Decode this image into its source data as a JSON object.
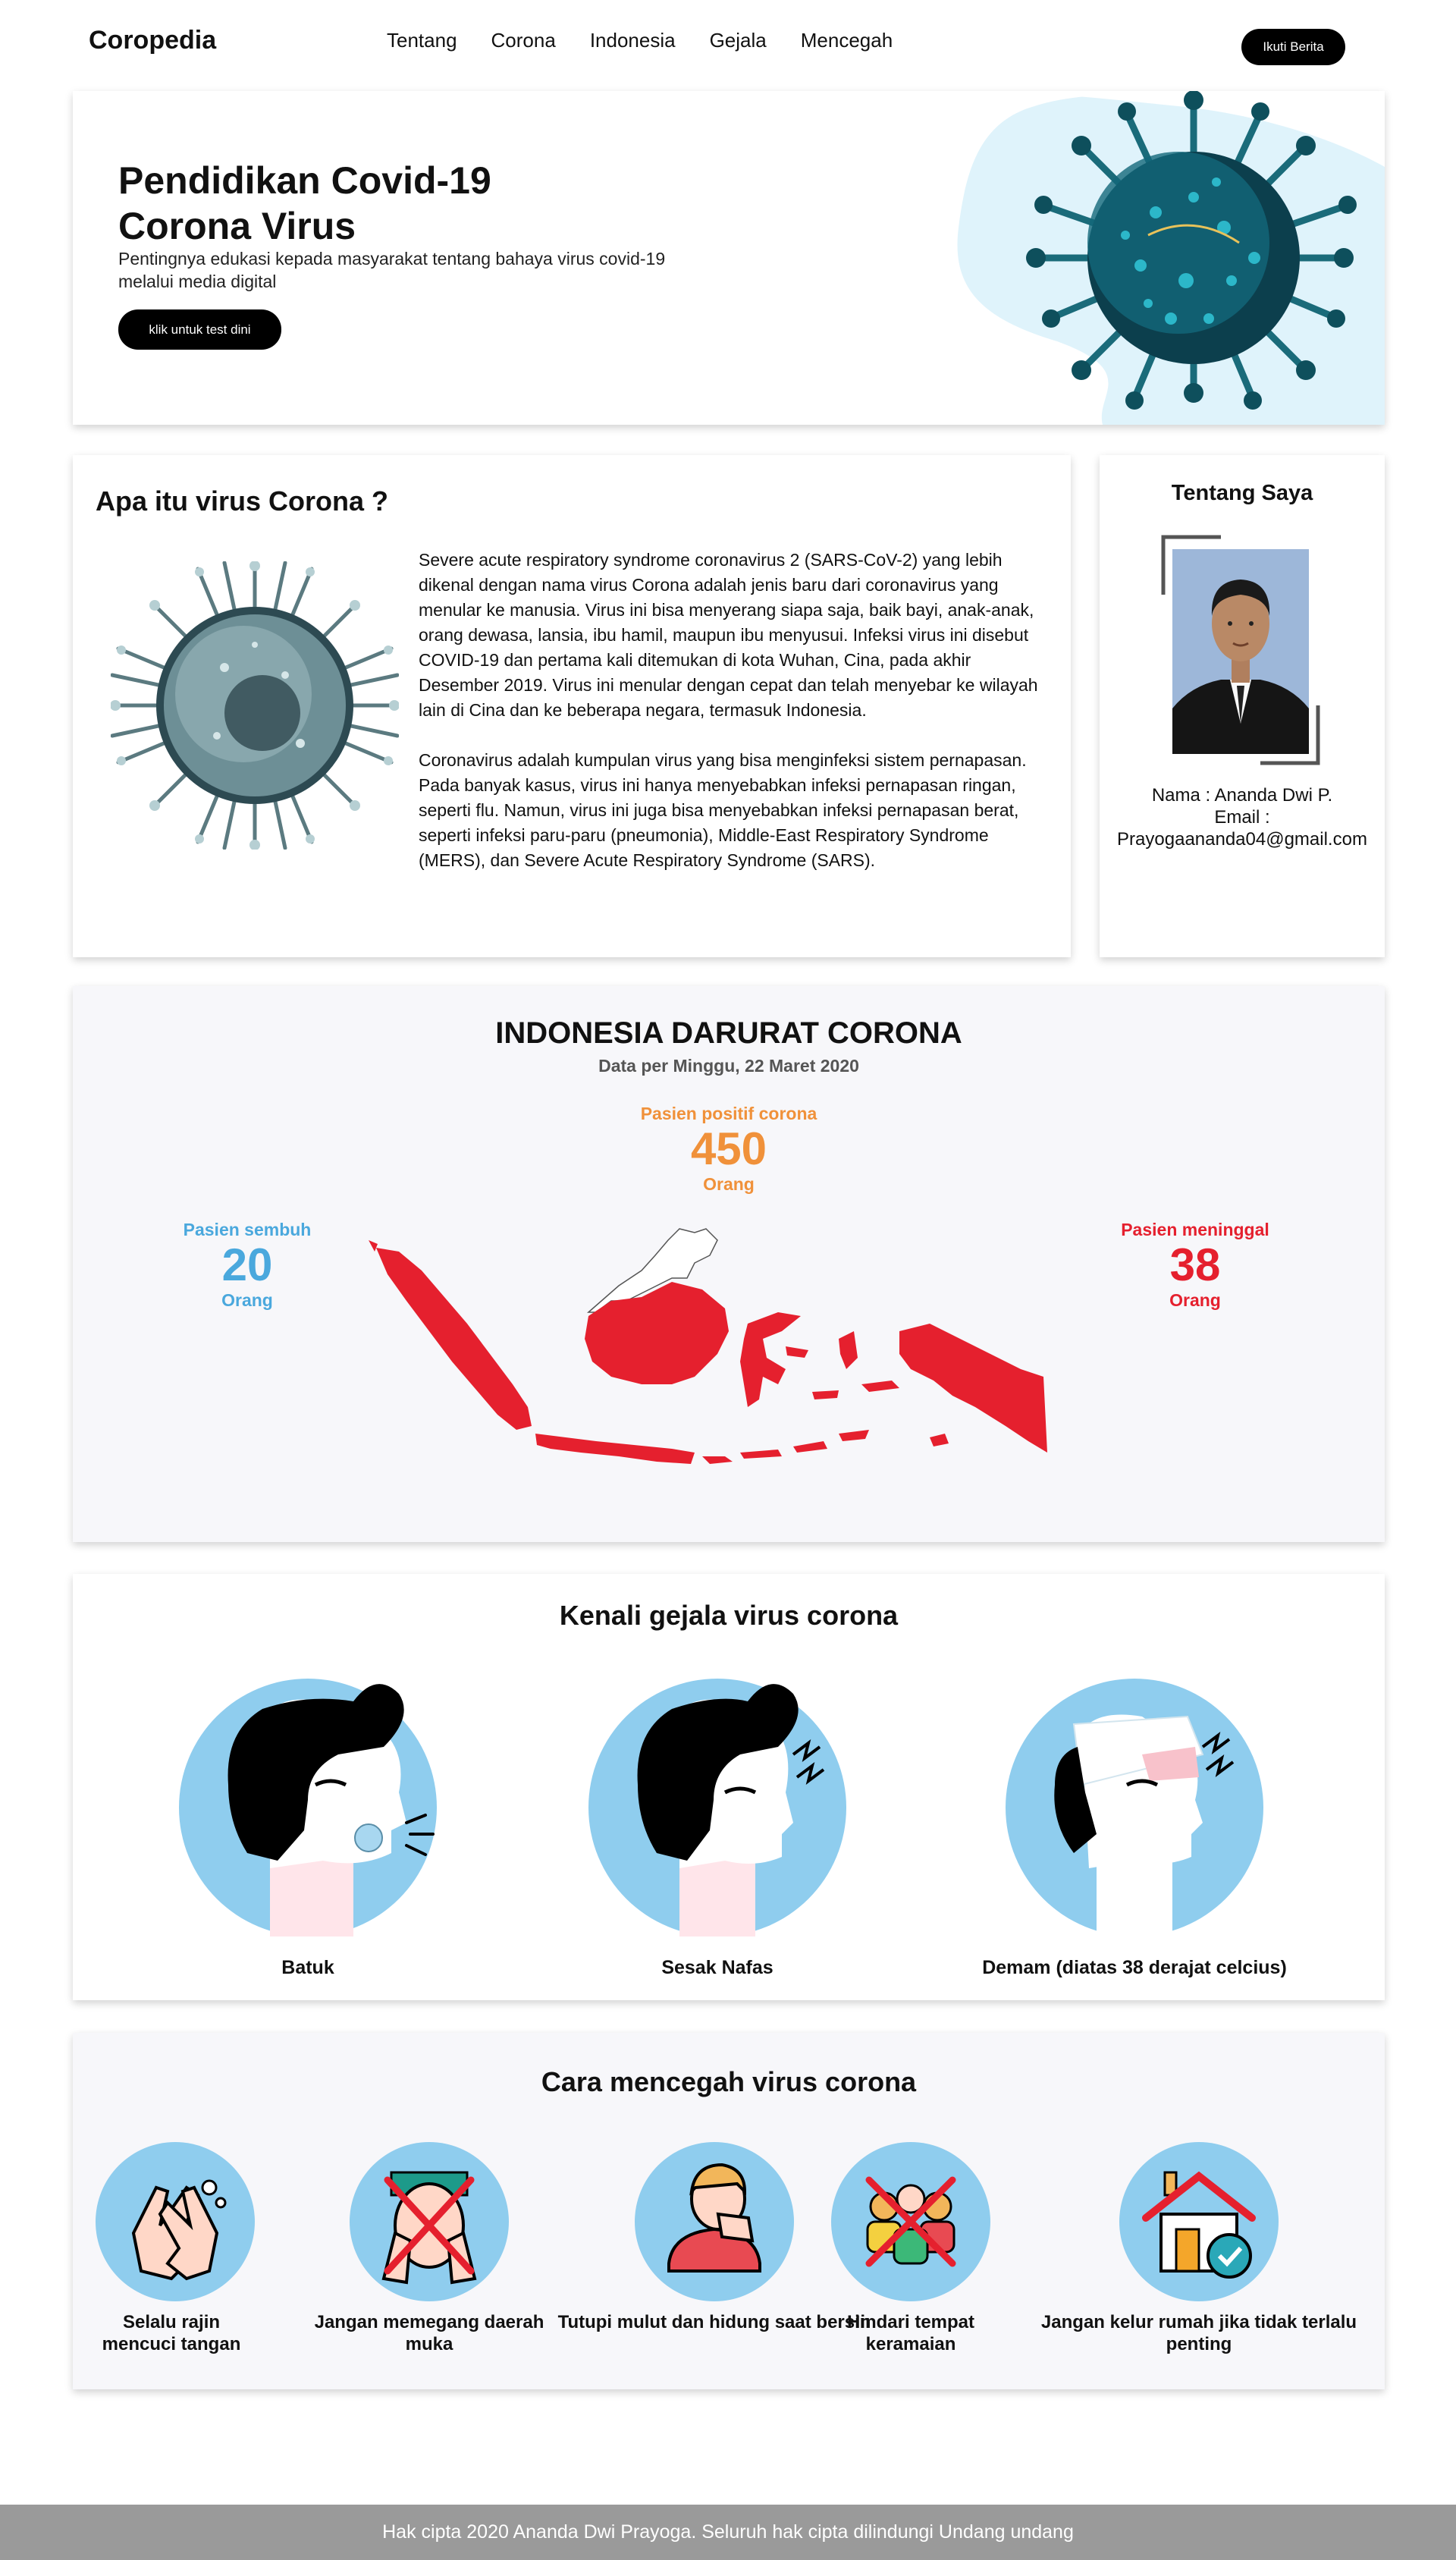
{
  "nav": {
    "brand": "Coropedia",
    "items": [
      "Tentang",
      "Corona",
      "Indonesia",
      "Gejala",
      "Mencegah"
    ],
    "button": "Ikuti Berita"
  },
  "hero": {
    "title_line1": "Pendidikan Covid-19",
    "title_line2": "Corona Virus",
    "subtitle": "Pentingnya edukasi kepada masyarakat tentang bahaya virus covid-19 melalui media digital",
    "button": "klik untuk test dini"
  },
  "about": {
    "title": "Apa itu virus Corona ?",
    "paragraph1": "Severe acute respiratory syndrome coronavirus 2 (SARS-CoV-2) yang lebih dikenal dengan nama virus Corona adalah jenis baru dari coronavirus yang menular ke manusia. Virus ini bisa menyerang siapa saja, baik bayi, anak-anak, orang dewasa, lansia, ibu hamil, maupun ibu menyusui. Infeksi virus ini disebut COVID-19 dan pertama kali ditemukan di kota Wuhan, Cina, pada akhir Desember 2019. Virus ini menular dengan cepat dan telah menyebar ke wilayah lain di Cina dan ke beberapa negara, termasuk Indonesia.",
    "paragraph2": "Coronavirus adalah kumpulan virus yang bisa menginfeksi sistem pernapasan. Pada banyak kasus, virus ini hanya menyebabkan infeksi pernapasan ringan, seperti flu. Namun, virus ini juga bisa menyebabkan infeksi pernapasan berat, seperti infeksi paru-paru (pneumonia), Middle-East Respiratory Syndrome (MERS), dan Severe Acute Respiratory Syndrome (SARS)."
  },
  "profile": {
    "title": "Tentang Saya",
    "name": "Nama : Ananda Dwi P.",
    "email_label": "Email :",
    "email": "Prayogaananda04@gmail.com"
  },
  "stats": {
    "title": "INDONESIA DARURAT CORONA",
    "date": "Data per Minggu, 22 Maret 2020",
    "positive": {
      "label": "Pasien positif corona",
      "value": "450",
      "unit": "Orang",
      "color": "#f0913a"
    },
    "recovered": {
      "label": "Pasien sembuh",
      "value": "20",
      "unit": "Orang",
      "color": "#4aa8dd"
    },
    "died": {
      "label": "Pasien meninggal",
      "value": "38",
      "unit": "Orang",
      "color": "#e5202e"
    },
    "map_color": "#e5202e"
  },
  "symptoms": {
    "title": "Kenali gejala virus corona",
    "items": [
      {
        "label": "Batuk",
        "icon": "cough-icon"
      },
      {
        "label": "Sesak Nafas",
        "icon": "breathless-icon"
      },
      {
        "label": "Demam (diatas 38 derajat celcius)",
        "icon": "fever-icon"
      }
    ]
  },
  "prevention": {
    "title": "Cara mencegah virus corona",
    "items": [
      {
        "label": "Selalu rajin mencuci tangan",
        "icon": "hand-wash-icon"
      },
      {
        "label": "Jangan memegang daerah muka",
        "icon": "no-touch-face-icon"
      },
      {
        "label": "Tutupi mulut dan hidung saat bersin",
        "icon": "cover-sneeze-icon"
      },
      {
        "label": "Hindari tempat keramaian",
        "icon": "avoid-crowd-icon"
      },
      {
        "label": "Jangan kelur rumah jika tidak terlalu penting",
        "icon": "stay-home-icon"
      }
    ]
  },
  "footer": "Hak cipta 2020 Ananda Dwi Prayoga. Seluruh hak cipta dilindungi Undang undang"
}
